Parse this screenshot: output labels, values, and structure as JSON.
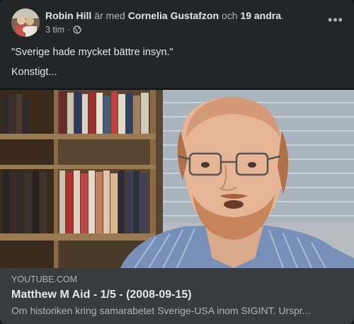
{
  "post": {
    "author": "Robin Hill",
    "with_text": "är med",
    "tagged": "Cornelia Gustafzon",
    "and_text": "och",
    "others": "19 andra",
    "period": ".",
    "time": "3 tim",
    "audience_icon": "globe-icon",
    "more_icon": "more-options-icon",
    "more_label": "•••",
    "body_lines": [
      "\"Sverige hade mycket bättre insyn.\"",
      "Konstigt..."
    ]
  },
  "link": {
    "domain": "YOUTUBE.COM",
    "title": "Matthew M Aid - 1/5 - (2008-09-15)",
    "description": "Om historiken kring samarabetet Sverige-USA inom SIGINT. Urspr..."
  }
}
